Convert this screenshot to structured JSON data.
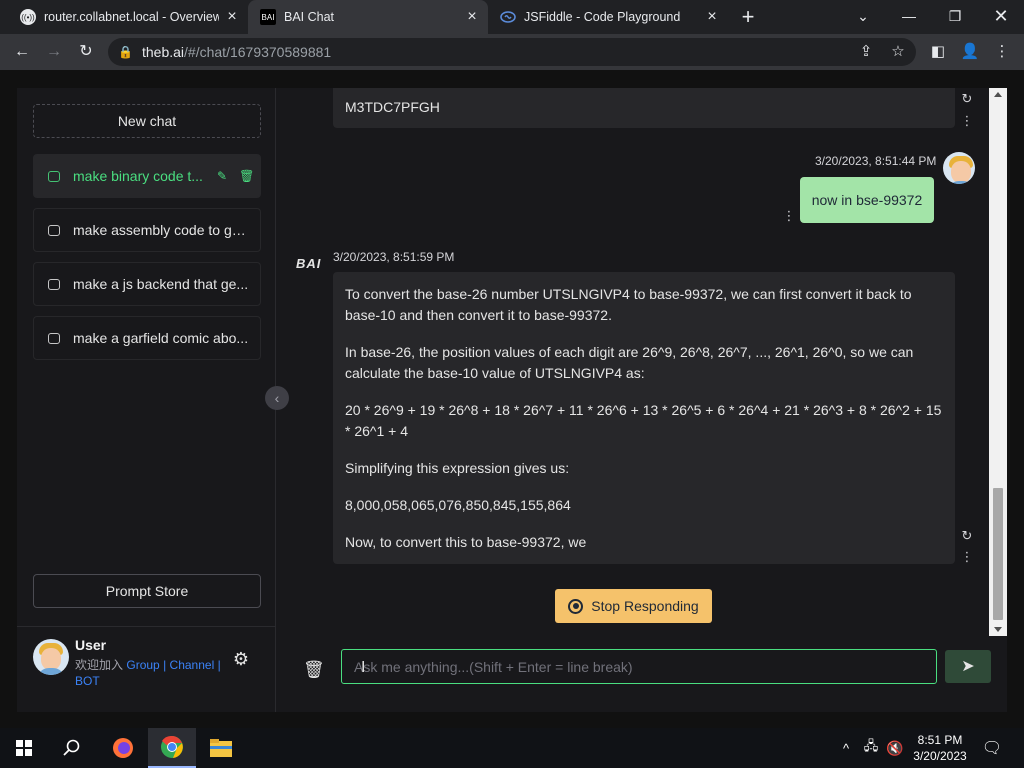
{
  "browser": {
    "tabs": [
      {
        "title": "router.collabnet.local - Overview",
        "active": false
      },
      {
        "title": "BAI Chat",
        "active": true
      },
      {
        "title": "JSFiddle - Code Playground",
        "active": false
      }
    ],
    "new_tab": "+",
    "url_host": "theb.ai",
    "url_path": "/#/chat/1679370589881"
  },
  "sidebar": {
    "new_chat_label": "New chat",
    "items": [
      {
        "label": "make binary code t...",
        "active": true
      },
      {
        "label": "make assembly code to ge...",
        "active": false
      },
      {
        "label": "make a js backend that ge...",
        "active": false
      },
      {
        "label": "make a garfield comic abo...",
        "active": false
      }
    ],
    "prompt_store_label": "Prompt Store",
    "user": {
      "name": "User",
      "text_prefix": "欢迎加入",
      "links": [
        "Group",
        "Channel",
        "BOT"
      ],
      "separator": "|"
    }
  },
  "chat": {
    "prev_message_tail": "M3TDC7PFGH",
    "user_message": {
      "timestamp": "3/20/2023, 8:51:44 PM",
      "text": "now in bse-99372"
    },
    "ai_message": {
      "logo": "BAI",
      "timestamp": "3/20/2023, 8:51:59 PM",
      "paragraphs": [
        "To convert the base-26 number UTSLNGIVP4 to base-99372, we can first convert it back to base-10 and then convert it to base-99372.",
        "In base-26, the position values of each digit are 26^9, 26^8, 26^7, ..., 26^1, 26^0, so we can calculate the base-10 value of UTSLNGIVP4 as:",
        "20 * 26^9 + 19 * 26^8 + 18 * 26^7 + 11 * 26^6 + 13 * 26^5 + 6 * 26^4 + 21 * 26^3 + 8 * 26^2 + 15 * 26^1 + 4",
        "Simplifying this expression gives us:",
        "8,000,058,065,076,850,845,155,864",
        "Now, to convert this to base-99372, we"
      ]
    },
    "stop_label": "Stop Responding",
    "input_placeholder": "Ask me anything...(Shift + Enter = line break)"
  },
  "taskbar": {
    "time": "8:51 PM",
    "date": "3/20/2023"
  },
  "colors": {
    "accent_green": "#4ade80",
    "user_bubble": "#a3e4a8",
    "stop_button": "#f5c26b",
    "link_blue": "#3b82f6"
  }
}
